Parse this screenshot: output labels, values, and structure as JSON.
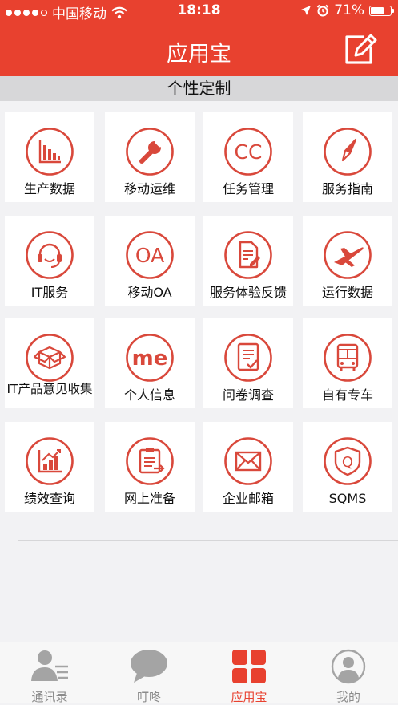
{
  "status_bar": {
    "carrier": "中国移动",
    "time": "18:18",
    "battery": "71%",
    "battery_level": 0.71
  },
  "nav": {
    "title": "应用宝",
    "edit_icon": "edit-icon"
  },
  "section": {
    "title": "个性定制"
  },
  "apps": [
    {
      "label": "生产数据",
      "icon": "bar-chart-icon"
    },
    {
      "label": "移动运维",
      "icon": "wrench-icon"
    },
    {
      "label": "任务管理",
      "icon": "cc-icon",
      "icon_text": "CC"
    },
    {
      "label": "服务指南",
      "icon": "compass-icon"
    },
    {
      "label": "IT服务",
      "icon": "headset-icon"
    },
    {
      "label": "移动OA",
      "icon": "oa-icon",
      "icon_text": "OA"
    },
    {
      "label": "服务体验反馈",
      "icon": "document-edit-icon"
    },
    {
      "label": "运行数据",
      "icon": "airplane-icon"
    },
    {
      "label": "IT产品意见收集",
      "icon": "box-icon"
    },
    {
      "label": "个人信息",
      "icon": "me-icon",
      "icon_text": "me"
    },
    {
      "label": "问卷调查",
      "icon": "checklist-icon"
    },
    {
      "label": "自有专车",
      "icon": "bus-icon"
    },
    {
      "label": "绩效查询",
      "icon": "growth-chart-icon"
    },
    {
      "label": "网上准备",
      "icon": "clipboard-icon"
    },
    {
      "label": "企业邮箱",
      "icon": "mail-icon"
    },
    {
      "label": "SQMS",
      "icon": "shield-q-icon",
      "icon_text": "Q"
    }
  ],
  "tabs": [
    {
      "label": "通讯录",
      "icon": "contacts-icon",
      "active": false
    },
    {
      "label": "叮咚",
      "icon": "chat-bubble-icon",
      "active": false
    },
    {
      "label": "应用宝",
      "icon": "app-grid-icon",
      "active": true
    },
    {
      "label": "我的",
      "icon": "profile-icon",
      "active": false
    }
  ],
  "colors": {
    "brand_red": "#e8412f",
    "icon_red": "#d9483b",
    "tab_inactive": "#8b8b8b",
    "background": "#f2f2f4"
  }
}
